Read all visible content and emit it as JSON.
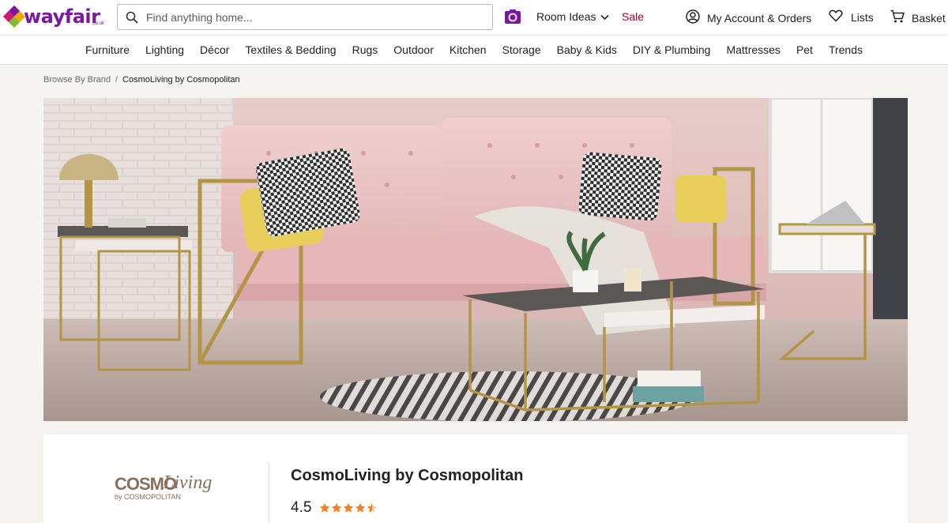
{
  "header": {
    "logo_text": "wayfair",
    "logo_sub": ".co.uk",
    "search_placeholder": "Find anything home...",
    "room_ideas_label": "Room Ideas",
    "sale_label": "Sale",
    "account_label": "My Account & Orders",
    "lists_label": "Lists",
    "basket_label": "Basket"
  },
  "categories": [
    "Furniture",
    "Lighting",
    "Décor",
    "Textiles & Bedding",
    "Rugs",
    "Outdoor",
    "Kitchen",
    "Storage",
    "Baby & Kids",
    "DIY & Plumbing",
    "Mattresses",
    "Pet",
    "Trends"
  ],
  "breadcrumb": {
    "parent": "Browse By Brand",
    "separator": "/",
    "current": "CosmoLiving by Cosmopolitan"
  },
  "hero": {
    "icon": "hero-room-image"
  },
  "brand": {
    "logo_word_a": "COSMO",
    "logo_word_b": "Living",
    "logo_sub": "by COSMOPOLITAN",
    "name": "CosmoLiving by Cosmopolitan",
    "rating": "4.5",
    "stars": 4.5
  },
  "colors": {
    "brand_purple": "#7b189f",
    "sale_red": "#b0002e",
    "star_orange": "#f58220"
  }
}
